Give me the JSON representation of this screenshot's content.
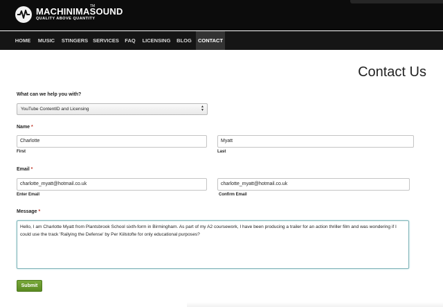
{
  "brand": {
    "name": "MACHINIMASOUND",
    "trademark": "TM",
    "tagline": "QUALITY ABOVE QUANTITY",
    "icon": "soundwave-logo-icon"
  },
  "nav": {
    "items": [
      {
        "label": "HOME",
        "active": false
      },
      {
        "label": "MUSIC",
        "active": false
      },
      {
        "label": "STINGERS",
        "active": false
      },
      {
        "label": "SERVICES",
        "active": false
      },
      {
        "label": "FAQ",
        "active": false
      },
      {
        "label": "LICENSING",
        "active": false
      },
      {
        "label": "BLOG",
        "active": false
      },
      {
        "label": "CONTACT",
        "active": true
      }
    ]
  },
  "page": {
    "title": "Contact Us"
  },
  "form": {
    "help": {
      "label": "What can we help you with?",
      "selected": "YouTube ContentID and Licensing"
    },
    "name": {
      "label": "Name",
      "required_mark": "*",
      "first_value": "Charlotte",
      "first_label": "First",
      "last_value": "Myatt",
      "last_label": "Last"
    },
    "email": {
      "label": "Email",
      "required_mark": "*",
      "enter_value": "charlotte_myatt@hotmail.co.uk",
      "enter_label": "Enter Email",
      "confirm_value": "charlotte_myatt@hotmail.co.uk",
      "confirm_label": "Confirm Email"
    },
    "message": {
      "label": "Message",
      "required_mark": "*",
      "value": "Hello, I am Charlotte Myatt from Plantsbrook School sixth-form in Birmingham. As part of my A2 coursework, I have been producing a trailer for an action thriller film and was wondering if I could use the track 'Railying the Defense' by Per Kiilstofte for only educational purposes?"
    },
    "submit_label": "Submit"
  },
  "colors": {
    "header_bg": "#0c0c0c",
    "nav_bg": "#151515",
    "nav_active_bg": "#333333",
    "required": "#c0392b",
    "submit_bg": "#6a9a2e",
    "focus_border": "#7fb3b8"
  }
}
